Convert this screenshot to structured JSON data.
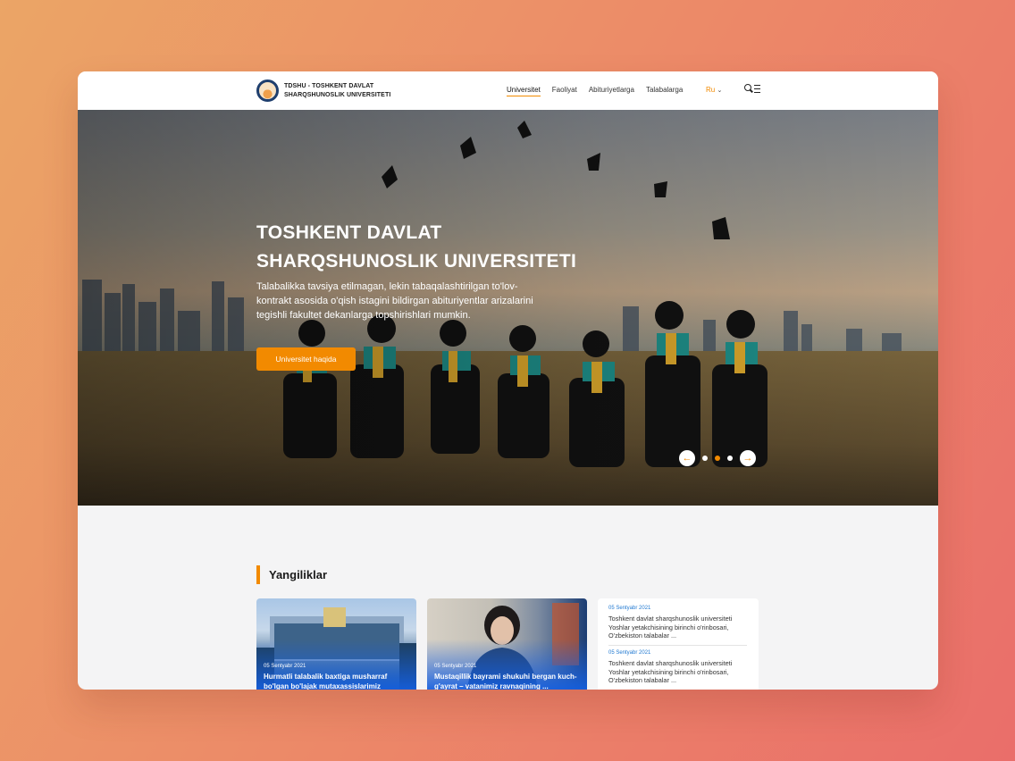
{
  "header": {
    "logo_line1": "TDSHU - TOSHKENT DAVLAT",
    "logo_line2": "SHARQSHUNOSLIK UNIVERSITETI",
    "nav": [
      "Universitet",
      "Faoliyat",
      "Abituriyetlarga",
      "Talabalarga"
    ],
    "active_nav": "Universitet",
    "lang": "Ru",
    "icons": [
      "search-icon",
      "menu-icon",
      "chevron-down-icon"
    ]
  },
  "hero": {
    "title_line1": "TOSHKENT DAVLAT",
    "title_line2": "SHARQSHUNOSLIK UNIVERSITETI",
    "subtitle": "Talabalikka tavsiya etilmagan, lekin  tabaqalashtirilgan to'lov-kontrakt asosida o'qish istagini bildirgan abituriyentlar arizalarini tegishli fakultet dekanlarga topshirishlari mumkin.",
    "button": "Universitet haqida",
    "slider": {
      "prev": "←",
      "next": "→",
      "slides": 3,
      "active_slide": 2
    }
  },
  "news": {
    "section_title": "Yangiliklar",
    "cards": [
      {
        "date": "05 Sentyabr 2021",
        "title": "Hurmatli talabalik baxtiga musharraf bo'lgan bo'lajak mutaxassislarimiz"
      },
      {
        "date": "05 Sentyabr 2021",
        "title": "Mustaqillik bayrami shukuhi bergan kuch-g'ayrat – vatanimiz ravnaqining ..."
      }
    ],
    "list": [
      {
        "date": "05 Sentyabr 2021",
        "text": "Toshkent davlat sharqshunoslik universiteti Yoshlar yetakchisining birinchi o'rinbosari, O'zbekiston talabalar ..."
      },
      {
        "date": "05 Sentyabr 2021",
        "text": "Toshkent davlat sharqshunoslik universiteti Yoshlar yetakchisining birinchi o'rinbosari, O'zbekiston talabalar ..."
      }
    ]
  },
  "colors": {
    "accent": "#f28a00",
    "link": "#1f78d1",
    "card_overlay": "#145fe1"
  }
}
